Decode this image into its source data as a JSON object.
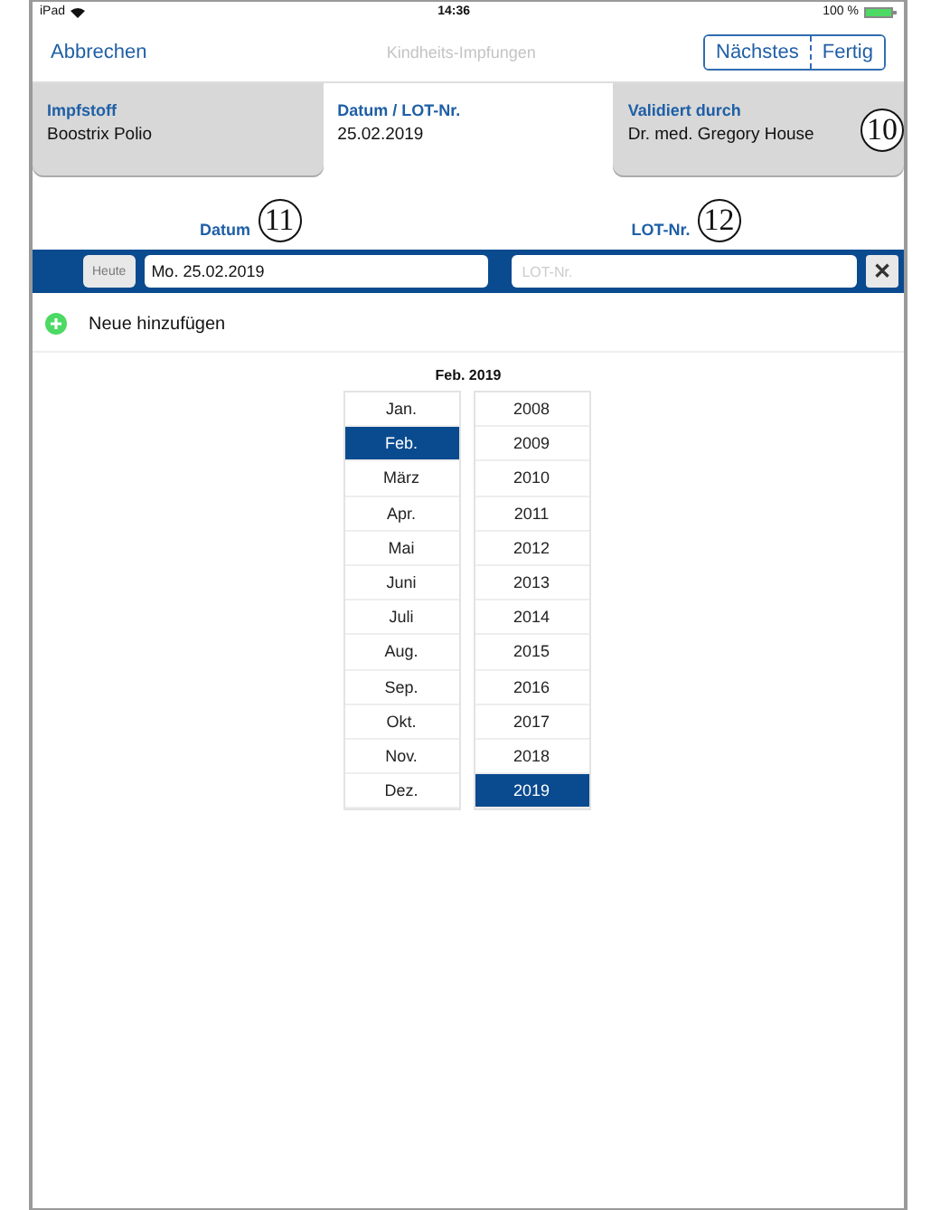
{
  "status_bar": {
    "device": "iPad",
    "time": "14:36",
    "battery": "100 %"
  },
  "nav": {
    "cancel": "Abbrechen",
    "title": "Kindheits-Impfungen",
    "buttons": [
      "Nächstes",
      "Fertig"
    ]
  },
  "tabs": [
    {
      "label": "Impfstoff",
      "value": "Boostrix Polio",
      "selected": false
    },
    {
      "label": "Datum / LOT-Nr.",
      "value": "25.02.2019",
      "selected": true
    },
    {
      "label": "Validiert durch",
      "value": "Dr. med. Gregory House",
      "selected": false,
      "callout": "10"
    }
  ],
  "columns": [
    {
      "label": "Datum",
      "callout": "11"
    },
    {
      "label": "LOT-Nr.",
      "callout": "12"
    }
  ],
  "entry": {
    "today": "Heute",
    "date": "Mo. 25.02.2019",
    "lot_placeholder": "LOT-Nr.",
    "clear": "✕"
  },
  "add": "Neue hinzufügen",
  "picker": {
    "title": "Feb. 2019",
    "months": [
      {
        "label": "Jan.",
        "selected": false
      },
      {
        "label": "Feb.",
        "selected": true
      },
      {
        "label": "März",
        "selected": false
      },
      {
        "label": "Apr.",
        "selected": false
      },
      {
        "label": "Mai",
        "selected": false
      },
      {
        "label": "Juni",
        "selected": false
      },
      {
        "label": "Juli",
        "selected": false
      },
      {
        "label": "Aug.",
        "selected": false
      },
      {
        "label": "Sep.",
        "selected": false
      },
      {
        "label": "Okt.",
        "selected": false
      },
      {
        "label": "Nov.",
        "selected": false
      },
      {
        "label": "Dez.",
        "selected": false
      }
    ],
    "years": [
      {
        "label": "2008",
        "selected": false
      },
      {
        "label": "2009",
        "selected": false
      },
      {
        "label": "2010",
        "selected": false
      },
      {
        "label": "2011",
        "selected": false
      },
      {
        "label": "2012",
        "selected": false
      },
      {
        "label": "2013",
        "selected": false
      },
      {
        "label": "2014",
        "selected": false
      },
      {
        "label": "2015",
        "selected": false
      },
      {
        "label": "2016",
        "selected": false
      },
      {
        "label": "2017",
        "selected": false
      },
      {
        "label": "2018",
        "selected": false
      },
      {
        "label": "2019",
        "selected": true
      }
    ]
  }
}
